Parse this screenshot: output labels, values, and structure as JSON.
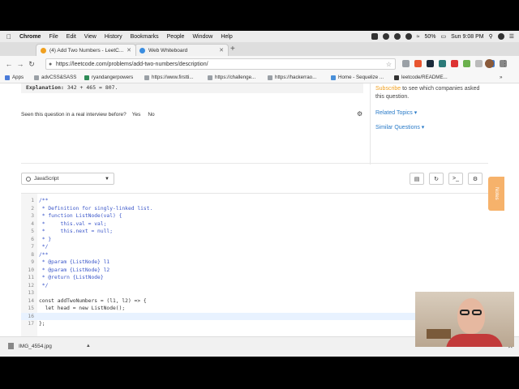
{
  "menubar": {
    "app": "Chrome",
    "items": [
      "File",
      "Edit",
      "View",
      "History",
      "Bookmarks",
      "People",
      "Window",
      "Help"
    ],
    "battery": "50%",
    "clock": "Sun 9:08 PM"
  },
  "tabs": [
    {
      "label": "(4) Add Two Numbers - LeetC...",
      "active": true,
      "fav_color": "#f0a020"
    },
    {
      "label": "Web Whiteboard",
      "active": false,
      "fav_color": "#3a8de0"
    }
  ],
  "address": {
    "url": "https://leetcode.com/problems/add-two-numbers/description/"
  },
  "bookmarks": [
    {
      "label": "Apps",
      "color": "#4a7bd8"
    },
    {
      "label": "advCSS&SASS",
      "color": "#9aa0a6"
    },
    {
      "label": "ryandangerpowers",
      "color": "#2e8b57"
    },
    {
      "label": "https://www.firstti...",
      "color": "#9aa0a6"
    },
    {
      "label": "https://challenge...",
      "color": "#9aa0a6"
    },
    {
      "label": "https://hackerrao...",
      "color": "#9aa0a6"
    },
    {
      "label": "Home - Sequelize ...",
      "color": "#4a90d9"
    },
    {
      "label": "leetcode/README...",
      "color": "#333333"
    }
  ],
  "problem": {
    "explanation_label": "Explanation:",
    "explanation_value": "342 + 465 = 807.",
    "seen_question": "Seen this question in a real interview before?",
    "yes": "Yes",
    "no": "No"
  },
  "sidebar": {
    "subscribe_link": "Subscribe",
    "subscribe_text": " to see which companies asked this question.",
    "related_topics": "Related Topics ▾",
    "similar_questions": "Similar Questions ▾"
  },
  "editor": {
    "language": "JavaScript",
    "notes_label": "Notes",
    "lines": [
      {
        "n": "1",
        "text": "/**",
        "cls": "cm"
      },
      {
        "n": "2",
        "text": " * Definition for singly-linked list.",
        "cls": "cm"
      },
      {
        "n": "3",
        "text": " * function ListNode(val) {",
        "cls": "cm"
      },
      {
        "n": "4",
        "text": " *     this.val = val;",
        "cls": "cm"
      },
      {
        "n": "5",
        "text": " *     this.next = null;",
        "cls": "cm"
      },
      {
        "n": "6",
        "text": " * }",
        "cls": "cm"
      },
      {
        "n": "7",
        "text": " */",
        "cls": "cm"
      },
      {
        "n": "8",
        "text": "/**",
        "cls": "cm"
      },
      {
        "n": "9",
        "text": " * @param {ListNode} l1",
        "cls": "cm"
      },
      {
        "n": "10",
        "text": " * @param {ListNode} l2",
        "cls": "cm"
      },
      {
        "n": "11",
        "text": " * @return {ListNode}",
        "cls": "cm"
      },
      {
        "n": "12",
        "text": " */",
        "cls": "cm"
      },
      {
        "n": "13",
        "text": "",
        "cls": "kw"
      },
      {
        "n": "14",
        "text": "const addTwoNumbers = (l1, l2) => {",
        "cls": "kw"
      },
      {
        "n": "15",
        "text": "  let head = new ListNode();",
        "cls": "kw"
      },
      {
        "n": "16",
        "text": "",
        "cls": "kw"
      },
      {
        "n": "17",
        "text": "};",
        "cls": "kw"
      }
    ]
  },
  "downloads": {
    "file": "IMG_4554.jpg"
  }
}
